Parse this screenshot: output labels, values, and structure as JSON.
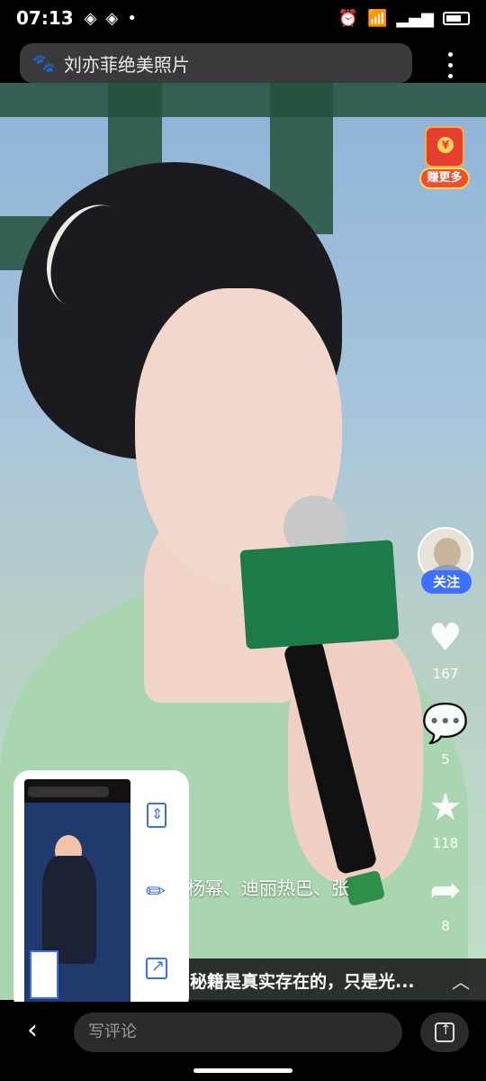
{
  "status_bar": {
    "time": "07:13",
    "left_icons": [
      "app-notification-icon",
      "app-notification-icon",
      "dot-icon"
    ],
    "right_icons": [
      "alarm-icon",
      "wifi-icon",
      "signal-icon",
      "battery-icon"
    ]
  },
  "search": {
    "logo_icon": "baidu-paw-icon",
    "query": "刘亦菲绝美照片",
    "more_icon": "more-vertical-icon"
  },
  "red_packet": {
    "symbol": "¥",
    "label": "赚更多"
  },
  "author": {
    "follow_label": "关注"
  },
  "actions": {
    "like_count": "167",
    "comment_count": "5",
    "favorite_count": "118",
    "share_count": "8"
  },
  "caption": {
    "line": "杨幂、迪丽热巴、张",
    "title": "秘籍是真实存在的，只是光..."
  },
  "screenshot_card": {
    "actions": [
      "scroll-screenshot-icon",
      "edit-icon",
      "share-icon"
    ]
  },
  "bottom_bar": {
    "comment_placeholder": "写评论"
  },
  "colors": {
    "follow_blue": "#3f6fff",
    "card_accent": "#3a6eff",
    "red_packet": "#e53f2f"
  }
}
